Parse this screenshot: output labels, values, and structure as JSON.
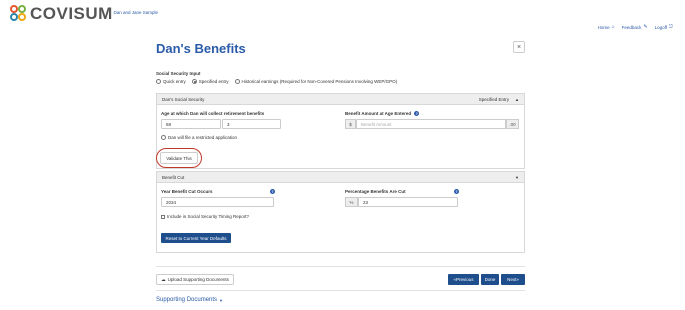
{
  "brand": {
    "logo_text": "COVISUM"
  },
  "breadcrumb": {
    "client": "Dan and Jane Sample"
  },
  "topnav": {
    "home": "Home",
    "feedback": "Feedback",
    "logoff": "Logoff"
  },
  "page": {
    "title": "Dan's Benefits",
    "close": "×"
  },
  "ss_input": {
    "label": "Social Security Input",
    "options": [
      "Quick entry",
      "Specified entry",
      "Historical earnings (Required for Non-Covered Pensions Involving WEP/GPO)"
    ],
    "selected": "Specified entry"
  },
  "dan_panel": {
    "title": "Dan's Social Security",
    "mode": "Specified Entry",
    "age_label": "Age at which Dan will collect retirement benefits",
    "age_years": "68",
    "age_months": "3",
    "benefit_label": "Benefit Amount at Age Entered",
    "currency": "$",
    "benefit_placeholder": "Benefit Amount",
    "cents": ".00",
    "restricted_label": "Dan will file a restricted application",
    "validate_label": "Validate This"
  },
  "benefit_cut": {
    "title": "Benefit Cut",
    "year_label": "Year Benefit Cut Occurs",
    "year_value": "2034",
    "pct_label": "Percentage Benefits Are Cut",
    "pct_symbol": "%",
    "pct_value": "23",
    "timing_label": "Include in Social Security Timing Report?",
    "reset_label": "Reset to Current Year Defaults"
  },
  "footer": {
    "upload_label": "Upload Supporting Documents",
    "previous_label": "Previous",
    "done_label": "Done",
    "next_label": "Next",
    "supporting_label": "Supporting Documents"
  }
}
